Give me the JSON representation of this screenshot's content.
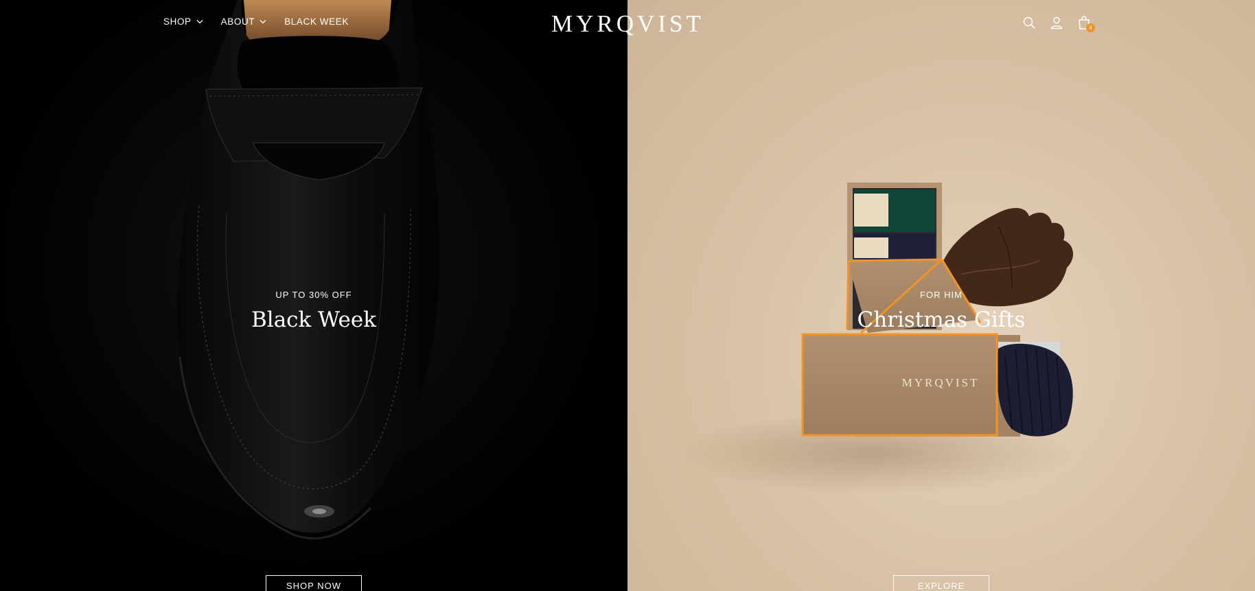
{
  "header": {
    "nav": [
      {
        "label": "SHOP"
      },
      {
        "label": "ABOUT"
      },
      {
        "label": "BLACK WEEK"
      }
    ],
    "logo": "MYRQVIST",
    "cart_count": "4",
    "icons": [
      "search-icon",
      "account-icon",
      "cart-icon"
    ]
  },
  "hero_left": {
    "eyebrow": "UP TO 30% OFF",
    "title": "Black Week",
    "cta": "SHOP NOW"
  },
  "hero_right": {
    "eyebrow": "FOR HIM",
    "title": "Christmas Gifts",
    "cta": "EXPLORE",
    "box_brand": "MYRQVIST"
  },
  "colors": {
    "accent": "#f2932a",
    "left_bg": "#000000",
    "right_bg": "#dcc6ad"
  }
}
